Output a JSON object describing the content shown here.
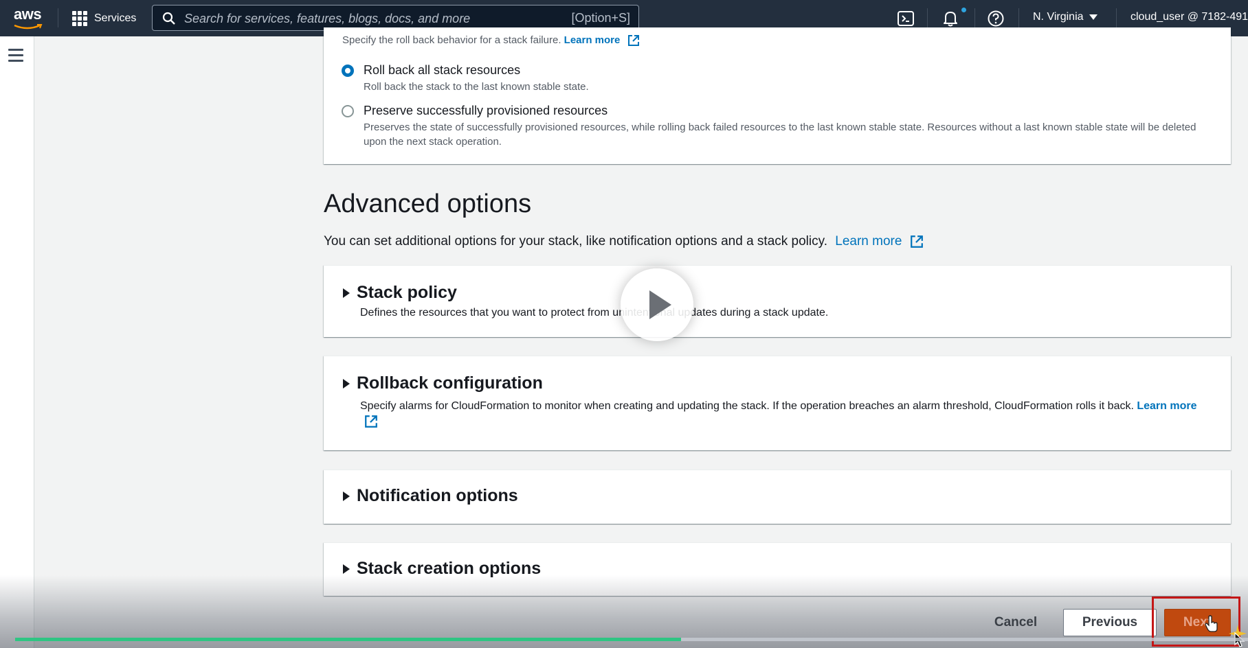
{
  "topnav": {
    "logo_text": "aws",
    "services_label": "Services",
    "search_placeholder": "Search for services, features, blogs, docs, and more",
    "search_shortcut": "[Option+S]",
    "region": "N. Virginia",
    "account": "cloud_user @ 7182-491"
  },
  "rollback": {
    "hint": "Specify the roll back behavior for a stack failure.",
    "hint_link": "Learn more",
    "options": [
      {
        "label": "Roll back all stack resources",
        "description": "Roll back the stack to the last known stable state.",
        "selected": true
      },
      {
        "label": "Preserve successfully provisioned resources",
        "description": "Preserves the state of successfully provisioned resources, while rolling back failed resources to the last known stable state. Resources without a last known stable state will be deleted upon the next stack operation.",
        "selected": false
      }
    ]
  },
  "advanced": {
    "title": "Advanced options",
    "description": "You can set additional options for your stack, like notification options and a stack policy.",
    "link": "Learn more",
    "sections": [
      {
        "title": "Stack policy",
        "description": "Defines the resources that you want to protect from unintentional updates during a stack update."
      },
      {
        "title": "Rollback configuration",
        "description": "Specify alarms for CloudFormation to monitor when creating and updating the stack. If the operation breaches an alarm threshold, CloudFormation rolls it back.",
        "link": "Learn more"
      },
      {
        "title": "Notification options"
      },
      {
        "title": "Stack creation options"
      }
    ]
  },
  "footer": {
    "cancel_label": "Cancel",
    "previous_label": "Previous",
    "next_label": "Next"
  },
  "video": {
    "progress_fraction": 0.54
  },
  "colors": {
    "nav_bg": "#232f3e",
    "link": "#0073bb",
    "primary_button": "#c0490f",
    "progress": "#2fc583",
    "highlight": "#c41616"
  }
}
